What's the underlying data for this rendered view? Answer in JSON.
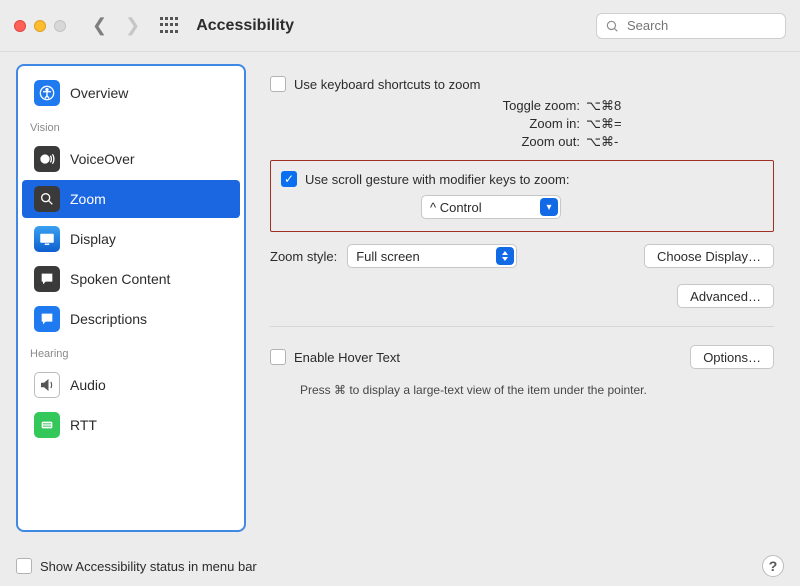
{
  "window": {
    "title": "Accessibility",
    "search_placeholder": "Search"
  },
  "sidebar": {
    "sections": {
      "vision_header": "Vision",
      "hearing_header": "Hearing"
    },
    "items": [
      {
        "label": "Overview"
      },
      {
        "label": "VoiceOver"
      },
      {
        "label": "Zoom"
      },
      {
        "label": "Display"
      },
      {
        "label": "Spoken Content"
      },
      {
        "label": "Descriptions"
      },
      {
        "label": "Audio"
      },
      {
        "label": "RTT"
      }
    ]
  },
  "zoom": {
    "kb_shortcuts_label": "Use keyboard shortcuts to zoom",
    "shortcuts": {
      "toggle_label": "Toggle zoom:",
      "toggle_keys": "⌥⌘8",
      "in_label": "Zoom in:",
      "in_keys": "⌥⌘=",
      "out_label": "Zoom out:",
      "out_keys": "⌥⌘-"
    },
    "scroll_gesture_label": "Use scroll gesture with modifier keys to zoom:",
    "scroll_modifier_value": "^ Control",
    "zoom_style_label": "Zoom style:",
    "zoom_style_value": "Full screen",
    "choose_display_btn": "Choose Display…",
    "advanced_btn": "Advanced…",
    "hover_text_label": "Enable Hover Text",
    "hover_options_btn": "Options…",
    "hover_hint": "Press ⌘ to display a large-text view of the item under the pointer."
  },
  "footer": {
    "status_label": "Show Accessibility status in menu bar"
  }
}
